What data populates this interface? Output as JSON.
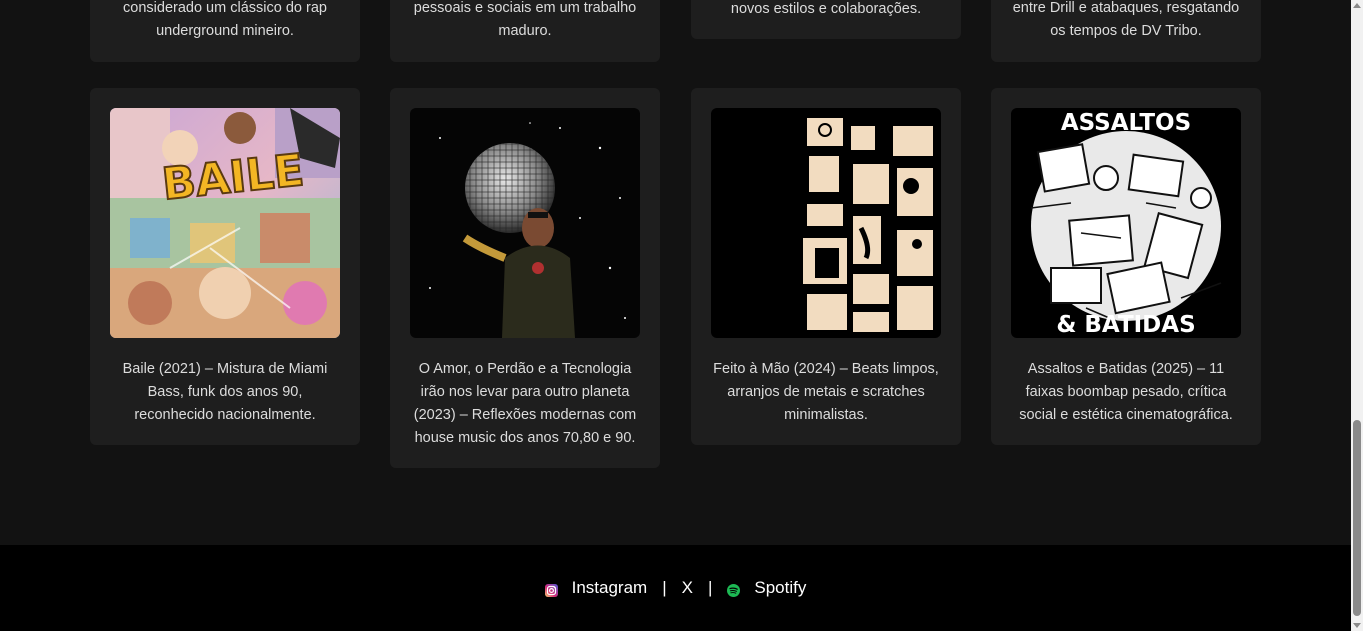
{
  "top_row": [
    {
      "line1": "considerado um clássico do rap",
      "line2": "underground mineiro."
    },
    {
      "line1": "pessoais e sociais em um trabalho",
      "line2": "maduro."
    },
    {
      "line1": "novos estilos e colaborações.",
      "line2": ""
    },
    {
      "line1": "entre Drill e atabaques, resgatando",
      "line2": "os tempos de DV Tribo."
    }
  ],
  "albums": [
    {
      "text": "Baile (2021) – Mistura de Miami Bass, funk dos anos 90, reconhecido nacionalmente.",
      "cover": "baile-cover"
    },
    {
      "text": "O Amor, o Perdão e a Tecnologia irão nos levar para outro planeta (2023) – Reflexões modernas com house music dos anos 70,80 e 90.",
      "cover": "disco-ball-cover"
    },
    {
      "text": "Feito à Mão (2024) – Beats limpos, arranjos de metais e scratches minimalistas.",
      "cover": "collage-cover"
    },
    {
      "text": "Assaltos e Batidas (2025) – 11 faixas boombap pesado, crítica social e estética cinematográfica.",
      "cover": "assaltos-cover",
      "cover_title_top": "ASSALTOS",
      "cover_title_bottom": "& BATIDAS",
      "baile_title": "BAILE"
    }
  ],
  "footer": {
    "instagram": "Instagram",
    "x": "X",
    "spotify": "Spotify",
    "separator": "|"
  },
  "colors": {
    "background": "#121212",
    "card": "#1e1e1e",
    "footer": "#000000",
    "spotify": "#1db954"
  }
}
